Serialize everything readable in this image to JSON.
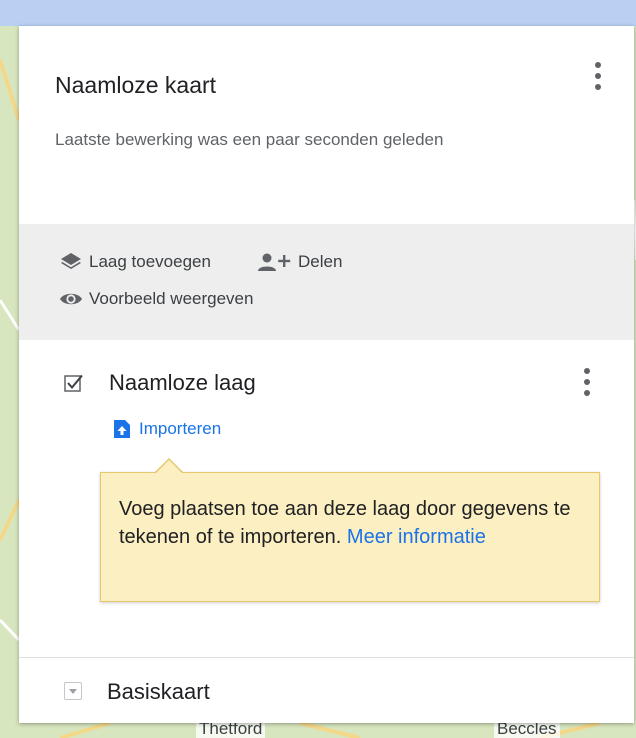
{
  "map": {
    "labels": {
      "thetford": "Thetford",
      "beccles": "Beccles"
    }
  },
  "panel": {
    "title": "Naamloze kaart",
    "subtitle": "Laatste bewerking was een paar seconden geleden",
    "menu_icon": "more-vert-icon"
  },
  "actions": {
    "add_layer": {
      "label": "Laag toevoegen",
      "icon": "layers-icon"
    },
    "share": {
      "label": "Delen",
      "icon": "person-add-icon"
    },
    "preview": {
      "label": "Voorbeeld weergeven",
      "icon": "eye-icon"
    }
  },
  "layer": {
    "name": "Naamloze laag",
    "checked": true,
    "import_label": "Importeren",
    "import_icon": "file-upload-icon",
    "menu_icon": "more-vert-icon"
  },
  "tooltip": {
    "text": "Voeg plaatsen toe aan deze laag door gegevens te tekenen of te importeren.",
    "link": "Meer informatie"
  },
  "basemap": {
    "label": "Basiskaart",
    "icon": "expand-icon"
  },
  "colors": {
    "accent": "#1a73e8",
    "tooltip_bg": "#fcefc2",
    "tooltip_border": "#e6c76c",
    "actions_bg": "#eeeeee",
    "map_land": "#d6e4bd",
    "map_water": "#b9d0f3"
  }
}
